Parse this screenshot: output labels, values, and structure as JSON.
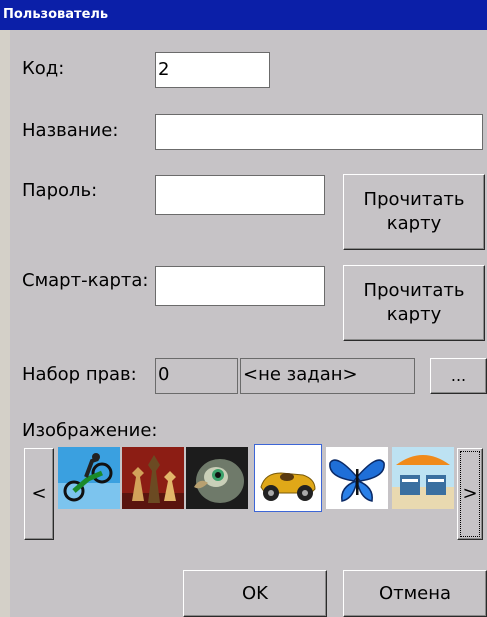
{
  "window": {
    "title": "Пользователь"
  },
  "form": {
    "code_label": "Код:",
    "code_value": "2",
    "name_label": "Название:",
    "name_value": "",
    "password_label": "Пароль:",
    "password_value": "",
    "read_card_button": "Прочитать карту",
    "smartcard_label": "Смарт-карта:",
    "smartcard_value": "",
    "read_card_button_2": "Прочитать карту",
    "rights_label": "Набор прав:",
    "rights_id": "0",
    "rights_name": "<не задан>",
    "rights_browse": "...",
    "image_label": "Изображение:",
    "prev_label": "<",
    "next_label": ">"
  },
  "images": [
    {
      "icon": "motocross-icon",
      "selected": false
    },
    {
      "icon": "chess-icon",
      "selected": false
    },
    {
      "icon": "parrot-icon",
      "selected": false
    },
    {
      "icon": "race-car-icon",
      "selected": true
    },
    {
      "icon": "butterfly-icon",
      "selected": false
    },
    {
      "icon": "beach-chairs-icon",
      "selected": false
    }
  ],
  "actions": {
    "ok": "OK",
    "cancel": "Отмена"
  },
  "colors": {
    "titlebar": "#0b1fa8",
    "face": "#c6c3c6",
    "selection": "#3d66d6"
  }
}
